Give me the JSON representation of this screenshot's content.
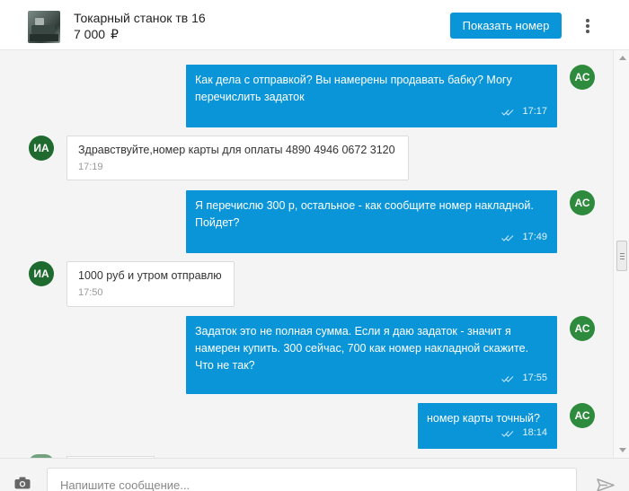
{
  "header": {
    "title": "Токарный станок тв 16",
    "price": "7 000",
    "currency": "₽",
    "show_number_label": "Показать номер",
    "menu_icon": "kebab-menu-icon",
    "thumb_icon": "listing-thumbnail"
  },
  "messages": [
    {
      "direction": "out",
      "avatar": "АС",
      "lines": [
        "Как дела с отправкой? Вы намерены продавать бабку? Могу",
        "перечислить задаток"
      ],
      "time": "17:17"
    },
    {
      "direction": "in",
      "avatar": "ИА",
      "lines": [
        "Здравствуйте,номер карты для оплаты 4890 4946 0672 3120"
      ],
      "time": "17:19"
    },
    {
      "direction": "out",
      "avatar": "АС",
      "lines": [
        "Я перечислю 300 р, остальное - как сообщите номер накладной.",
        "Пойдет?"
      ],
      "time": "17:49"
    },
    {
      "direction": "in",
      "avatar": "ИА",
      "lines": [
        "1000 руб и утром отправлю"
      ],
      "time": "17:50"
    },
    {
      "direction": "out",
      "avatar": "АС",
      "lines": [
        "Задаток это не полная сумма. Если я даю задаток - значит я",
        "намерен купить. 300 сейчас, 700 как номер накладной скажите.",
        "Что не так?"
      ],
      "time": "17:55"
    },
    {
      "direction": "out",
      "avatar": "АС",
      "lines": [
        "номер карты точный?"
      ],
      "time": "18:14"
    }
  ],
  "composer": {
    "placeholder": "Напишите сообщение...",
    "attach_icon": "camera-icon",
    "send_icon": "send-icon"
  },
  "colors": {
    "accent": "#0a95d8",
    "avatar_out": "#2e8b3e",
    "avatar_in": "#1f6b2f",
    "chat_bg": "#f4f4f4"
  }
}
